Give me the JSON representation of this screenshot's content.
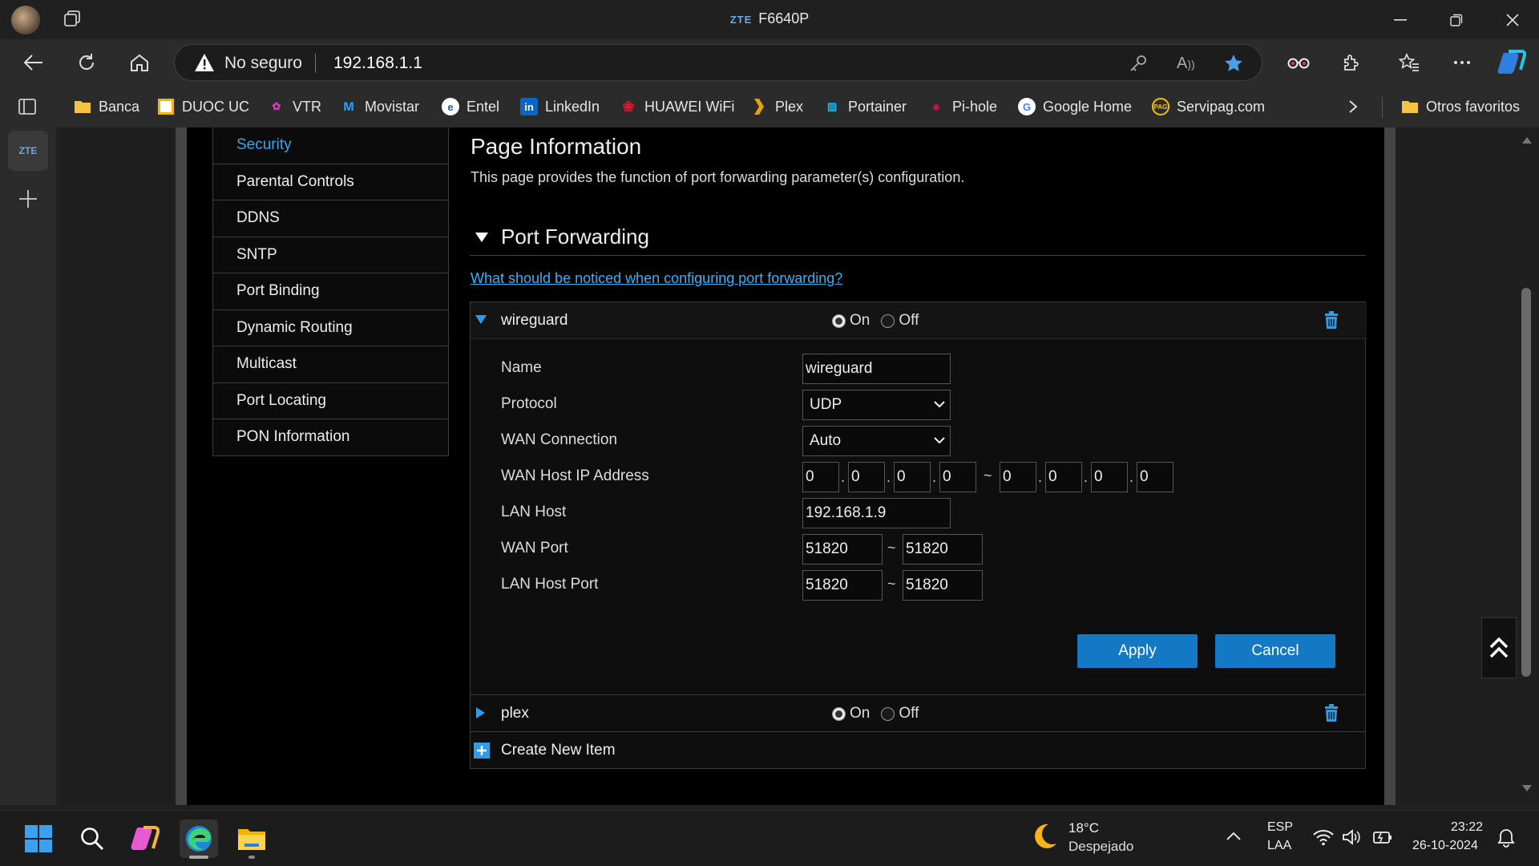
{
  "window": {
    "title_brand": "ZTE",
    "title": "F6640P"
  },
  "toolbar": {
    "security_label": "No seguro",
    "url": "192.168.1.1"
  },
  "favorites": [
    {
      "label": "Banca",
      "icon": "folder-icon"
    },
    {
      "label": "DUOC UC",
      "icon": "duoc-icon"
    },
    {
      "label": "VTR",
      "icon": "vtr-icon"
    },
    {
      "label": "Movistar",
      "icon": "movistar-icon"
    },
    {
      "label": "Entel",
      "icon": "entel-icon"
    },
    {
      "label": "LinkedIn",
      "icon": "linkedin-icon"
    },
    {
      "label": "HUAWEI WiFi",
      "icon": "huawei-icon"
    },
    {
      "label": "Plex",
      "icon": "plex-icon"
    },
    {
      "label": "Portainer",
      "icon": "portainer-icon"
    },
    {
      "label": "Pi-hole",
      "icon": "pihole-icon"
    },
    {
      "label": "Google Home",
      "icon": "google-icon"
    },
    {
      "label": "Servipag.com",
      "icon": "servipag-icon"
    }
  ],
  "favorites_other": "Otros favoritos",
  "vertical_tab": {
    "label": "ZTE"
  },
  "menu": [
    {
      "label": "Security",
      "active": true
    },
    {
      "label": "Parental Controls",
      "active": false
    },
    {
      "label": "DDNS",
      "active": false
    },
    {
      "label": "SNTP",
      "active": false
    },
    {
      "label": "Port Binding",
      "active": false
    },
    {
      "label": "Dynamic Routing",
      "active": false
    },
    {
      "label": "Multicast",
      "active": false
    },
    {
      "label": "Port Locating",
      "active": false
    },
    {
      "label": "PON Information",
      "active": false
    }
  ],
  "page": {
    "title": "Page Information",
    "description": "This page provides the function of port forwarding parameter(s) configuration.",
    "section_title": "Port Forwarding",
    "help_link": "What should be noticed when configuring port forwarding?"
  },
  "rules": [
    {
      "name": "wireguard",
      "expanded": true,
      "on_label": "On",
      "off_label": "Off",
      "state": "On",
      "fields": {
        "name_label": "Name",
        "name_value": "wireguard",
        "protocol_label": "Protocol",
        "protocol_value": "UDP",
        "wan_conn_label": "WAN Connection",
        "wan_conn_value": "Auto",
        "wan_host_label": "WAN Host IP Address",
        "wan_host_start": [
          "0",
          "0",
          "0",
          "0"
        ],
        "wan_host_end": [
          "0",
          "0",
          "0",
          "0"
        ],
        "lan_host_label": "LAN Host",
        "lan_host_value": "192.168.1.9",
        "wan_port_label": "WAN Port",
        "wan_port_start": "51820",
        "wan_port_end": "51820",
        "lan_port_label": "LAN Host Port",
        "lan_port_start": "51820",
        "lan_port_end": "51820"
      },
      "apply_label": "Apply",
      "cancel_label": "Cancel"
    },
    {
      "name": "plex",
      "expanded": false,
      "on_label": "On",
      "off_label": "Off",
      "state": "On"
    }
  ],
  "create_new": "Create New Item",
  "range_separator": "~",
  "ip_separator": ".",
  "taskbar": {
    "weather_temp": "18°C",
    "weather_desc": "Despejado",
    "lang": "ESP",
    "layout": "LAA",
    "time": "23:22",
    "date": "26-10-2024"
  },
  "colors": {
    "accent": "#1379c4",
    "link": "#3ab0f5",
    "active_menu": "#3aa4e8"
  }
}
